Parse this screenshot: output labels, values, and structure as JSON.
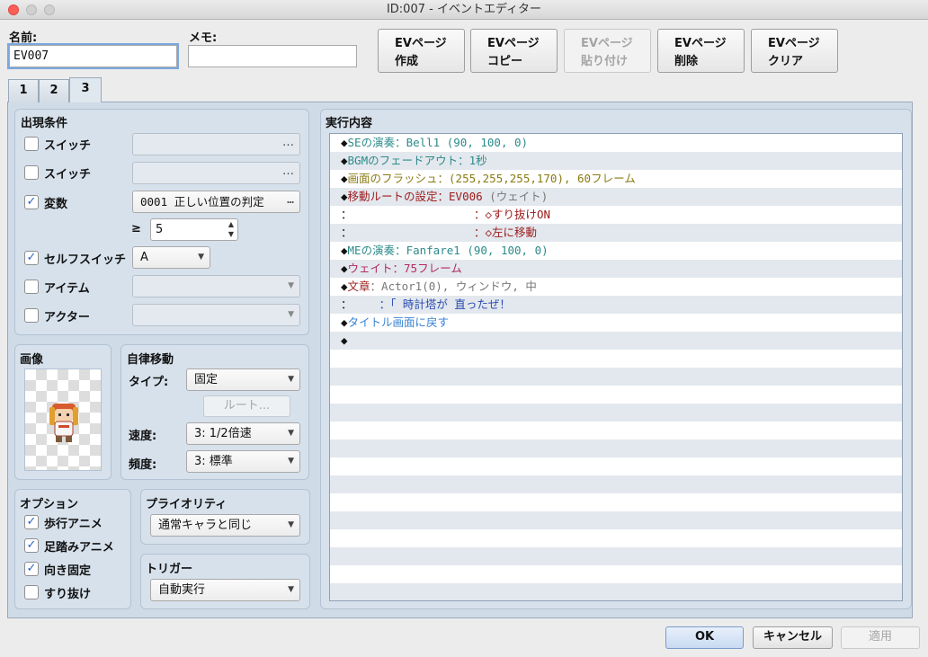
{
  "window": {
    "title": "ID:007 - イベントエディター"
  },
  "header": {
    "name_label": "名前:",
    "name_value": "EV007",
    "memo_label": "メモ:",
    "memo_value": "",
    "buttons": [
      {
        "line1": "EVページ",
        "line2": "作成",
        "enabled": true
      },
      {
        "line1": "EVページ",
        "line2": "コピー",
        "enabled": true
      },
      {
        "line1": "EVページ",
        "line2": "貼り付け",
        "enabled": false
      },
      {
        "line1": "EVページ",
        "line2": "削除",
        "enabled": true
      },
      {
        "line1": "EVページ",
        "line2": "クリア",
        "enabled": true
      }
    ]
  },
  "tabs": [
    {
      "label": "1"
    },
    {
      "label": "2"
    },
    {
      "label": "3"
    }
  ],
  "conditions": {
    "title": "出現条件",
    "switch1": {
      "label": "スイッチ",
      "checked": false,
      "value": "",
      "btn": "…"
    },
    "switch2": {
      "label": "スイッチ",
      "checked": false,
      "value": "",
      "btn": "…"
    },
    "variable": {
      "label": "変数",
      "checked": true,
      "value": "0001 正しい位置の判定",
      "btn": "…",
      "op": "≥",
      "number": "5"
    },
    "selfswitch": {
      "label": "セルフスイッチ",
      "checked": true,
      "value": "A"
    },
    "item": {
      "label": "アイテム",
      "checked": false,
      "value": ""
    },
    "actor": {
      "label": "アクター",
      "checked": false,
      "value": ""
    }
  },
  "image": {
    "title": "画像"
  },
  "autonomous": {
    "title": "自律移動",
    "type_label": "タイプ:",
    "type_value": "固定",
    "route_button": "ルート...",
    "speed_label": "速度:",
    "speed_value": "3: 1/2倍速",
    "freq_label": "頻度:",
    "freq_value": "3: 標準"
  },
  "options": {
    "title": "オプション",
    "items": [
      {
        "label": "歩行アニメ",
        "checked": true
      },
      {
        "label": "足踏みアニメ",
        "checked": true
      },
      {
        "label": "向き固定",
        "checked": true
      },
      {
        "label": "すり抜け",
        "checked": false
      }
    ]
  },
  "priority": {
    "title": "プライオリティ",
    "value": "通常キャラと同じ"
  },
  "trigger": {
    "title": "トリガー",
    "value": "自動実行"
  },
  "contents": {
    "title": "実行内容",
    "rows": [
      {
        "prefix": "◆",
        "text": "SEの演奏：Bell1 (90, 100, 0)",
        "color": "cTeal"
      },
      {
        "prefix": "◆",
        "text": "BGMのフェードアウト：1秒",
        "color": "cTeal"
      },
      {
        "prefix": "◆",
        "text": "画面のフラッシュ：(255,255,255,170), 60フレーム",
        "color": "cOlive"
      },
      {
        "prefix": "◆",
        "text": "移動ルートの設定：EV006",
        "extra": " (ウェイト)",
        "color": "cRed"
      },
      {
        "prefix": "：",
        "text": "                  ：◇すり抜けON",
        "color": "cRed"
      },
      {
        "prefix": "：",
        "text": "                  ：◇左に移動",
        "color": "cRed"
      },
      {
        "prefix": "◆",
        "text": "MEの演奏：Fanfare1 (90, 100, 0)",
        "color": "cTeal"
      },
      {
        "prefix": "◆",
        "text": "ウェイト：75フレーム",
        "color": "cPink"
      },
      {
        "prefix": "◆",
        "text": "文章",
        "extra": "：Actor1(0), ウィンドウ, 中",
        "color": "cRed"
      },
      {
        "prefix": "：",
        "text": "    ：「 時計塔が 直ったぜ！",
        "color": "cBlue"
      },
      {
        "prefix": "◆",
        "text": "タイトル画面に戻す",
        "color": "cLblue"
      },
      {
        "prefix": "◆",
        "text": "",
        "color": "cBlack"
      }
    ]
  },
  "footer": {
    "ok": "OK",
    "cancel": "キャンセル",
    "apply": "適用"
  },
  "colors": {
    "accent": "#3a84d6",
    "panel": "#d6e1ec"
  }
}
